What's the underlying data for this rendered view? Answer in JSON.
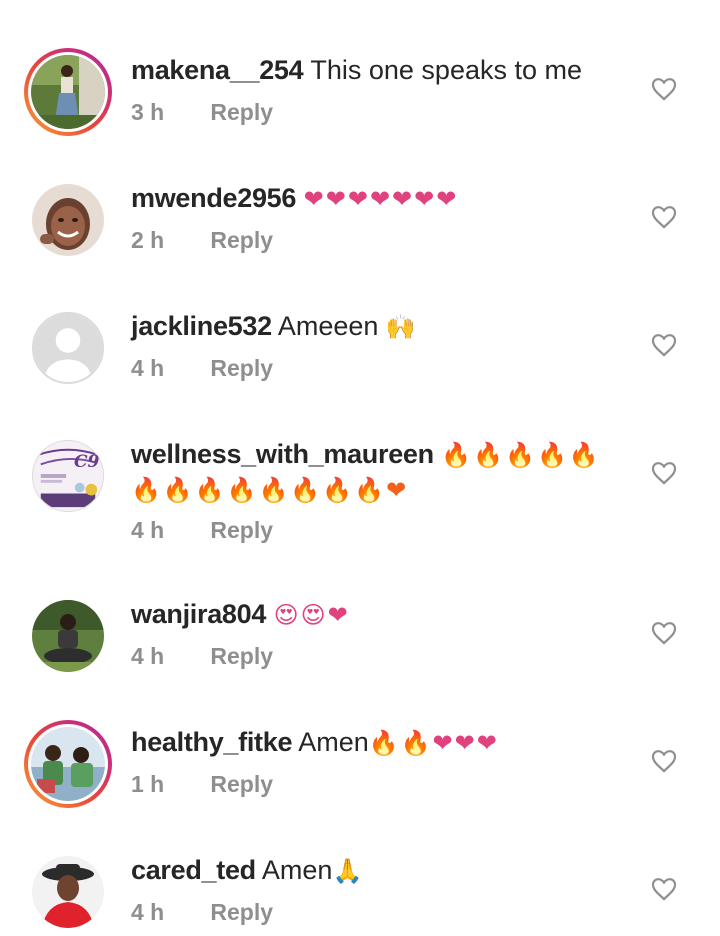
{
  "comments": [
    {
      "username": "makena__254",
      "text": "This one speaks to me",
      "emoji": "",
      "time": "3 h",
      "reply": "Reply",
      "avatar_icon": "woman-standing-garden-avatar-icon"
    },
    {
      "username": "mwende2956",
      "text": "",
      "emoji": "❤❤❤❤❤❤❤",
      "time": "2 h",
      "reply": "Reply",
      "avatar_icon": "smiling-woman-avatar-icon"
    },
    {
      "username": "jackline532",
      "text": "Ameeen",
      "emoji": "🙌",
      "time": "4 h",
      "reply": "Reply",
      "avatar_icon": "default-profile-avatar-icon"
    },
    {
      "username": "wellness_with_maureen",
      "text": "",
      "emoji": "🔥🔥🔥🔥🔥",
      "emoji_line2": "🔥🔥🔥🔥🔥🔥🔥🔥❤",
      "time": "4 h",
      "reply": "Reply",
      "avatar_icon": "wellness-logo-avatar-icon",
      "avatar_text": "C9"
    },
    {
      "username": "wanjira804",
      "text": "",
      "emoji": "😍😍❤",
      "time": "4 h",
      "reply": "Reply",
      "avatar_icon": "woman-sitting-outdoors-avatar-icon"
    },
    {
      "username": "healthy_fitke",
      "text": "Amen",
      "emoji": "🔥🔥❤❤❤",
      "time": "1 h",
      "reply": "Reply",
      "avatar_icon": "women-group-avatar-icon"
    },
    {
      "username": "cared_ted",
      "text": "Amen",
      "emoji": "🙏",
      "time": "4 h",
      "reply": "Reply",
      "avatar_icon": "woman-hat-red-dress-avatar-icon"
    }
  ],
  "colors": {
    "username": "#262626",
    "meta": "#8e8e8e",
    "heart": "#e0427f",
    "fire": "#f0611c",
    "story_ring_start": "#f9a236",
    "story_ring_end": "#b52c97"
  }
}
